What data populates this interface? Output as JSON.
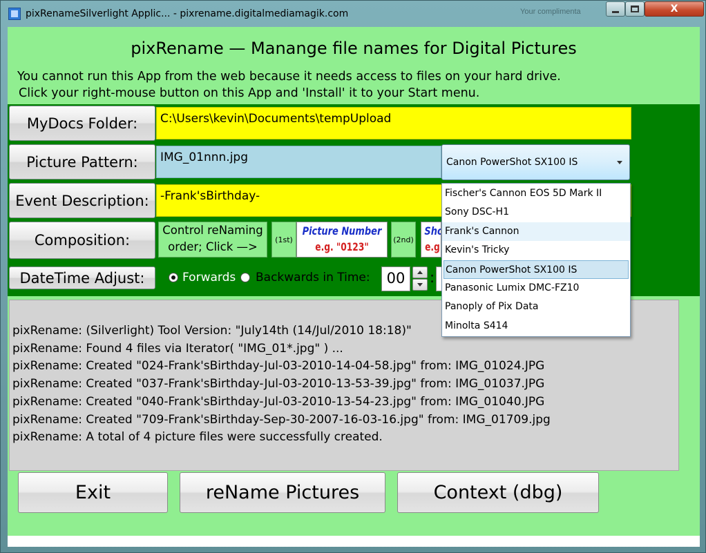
{
  "window": {
    "title": "pixRenameSilverlight Applic... - pixrename.digitalmediamagik.com",
    "background_text": "Your complimenta",
    "min_label": "",
    "max_label": "",
    "close_label": "X"
  },
  "header": {
    "title": "pixRename — Manange file names for Digital Pictures",
    "note_line1": "You cannot run this App from the web because it needs access to files on your hard drive.",
    "note_line2": "Click your right-mouse button on this App and 'Install' it to your Start menu."
  },
  "form": {
    "mydocs_button": "MyDocs Folder:",
    "mydocs_value": "C:\\Users\\kevin\\Documents\\tempUpload",
    "pattern_button": "Picture Pattern:",
    "pattern_value": "IMG_01nnn.jpg",
    "camera_selected": "Canon PowerShot SX100 IS",
    "event_button": "Event Description:",
    "event_value": "-Frank'sBirthday-",
    "compose_button": "Composition:",
    "compose_desc_line1": "Control reNaming",
    "compose_desc_line2": "order;  Click —>",
    "order_first": "(1st)",
    "order_second": "(2nd)",
    "sample1_title": "Picture Number",
    "sample1_eg": "e.g.  \"0123\"",
    "sample2_title": "Shot",
    "sample2_eg": "e.g.",
    "datetime_button": "DateTime Adjust:",
    "forwards_label": "Forwards",
    "backwards_label": "Backwards",
    "in_time_label": " in Time:",
    "hours_value": "00",
    "colon": ":"
  },
  "camera_options": [
    "Fischer's Cannon EOS 5D Mark II",
    "Sony DSC-H1",
    "Frank's Cannon",
    "Kevin's Tricky",
    "Canon PowerShot SX100 IS",
    "Panasonic Lumix DMC-FZ10",
    "Panoply of Pix Data",
    "Minolta S414"
  ],
  "log": [
    "pixRename: (Silverlight) Tool Version: \"July14th (14/Jul/2010 18:18)\"",
    "pixRename: Found 4 files via Iterator( \"IMG_01*.jpg\" ) ...",
    "pixRename: Created \"024-Frank'sBirthday-Jul-03-2010-14-04-58.jpg\" from: IMG_01024.JPG",
    "pixRename: Created \"037-Frank'sBirthday-Jul-03-2010-13-53-39.jpg\" from: IMG_01037.JPG",
    "pixRename: Created \"040-Frank'sBirthday-Jul-03-2010-13-54-23.jpg\" from: IMG_01040.JPG",
    "pixRename: Created \"709-Frank'sBirthday-Sep-30-2007-16-03-16.jpg\" from: IMG_01709.jpg",
    "pixRename: A total of 4 picture files were successfully created."
  ],
  "actions": {
    "exit": "Exit",
    "rename": "reName Pictures",
    "context": "Context (dbg)"
  },
  "colors": {
    "client_bg": "#90ee90",
    "panel_bg": "#008000",
    "field_yellow": "#ffff00",
    "field_blue": "#add8e6",
    "log_bg": "#d3d3d3"
  },
  "icons": {
    "app": "app-icon",
    "minimize": "minimize-icon",
    "maximize": "maximize-icon",
    "close": "close-icon",
    "combo_arrow": "chevron-down-icon"
  }
}
